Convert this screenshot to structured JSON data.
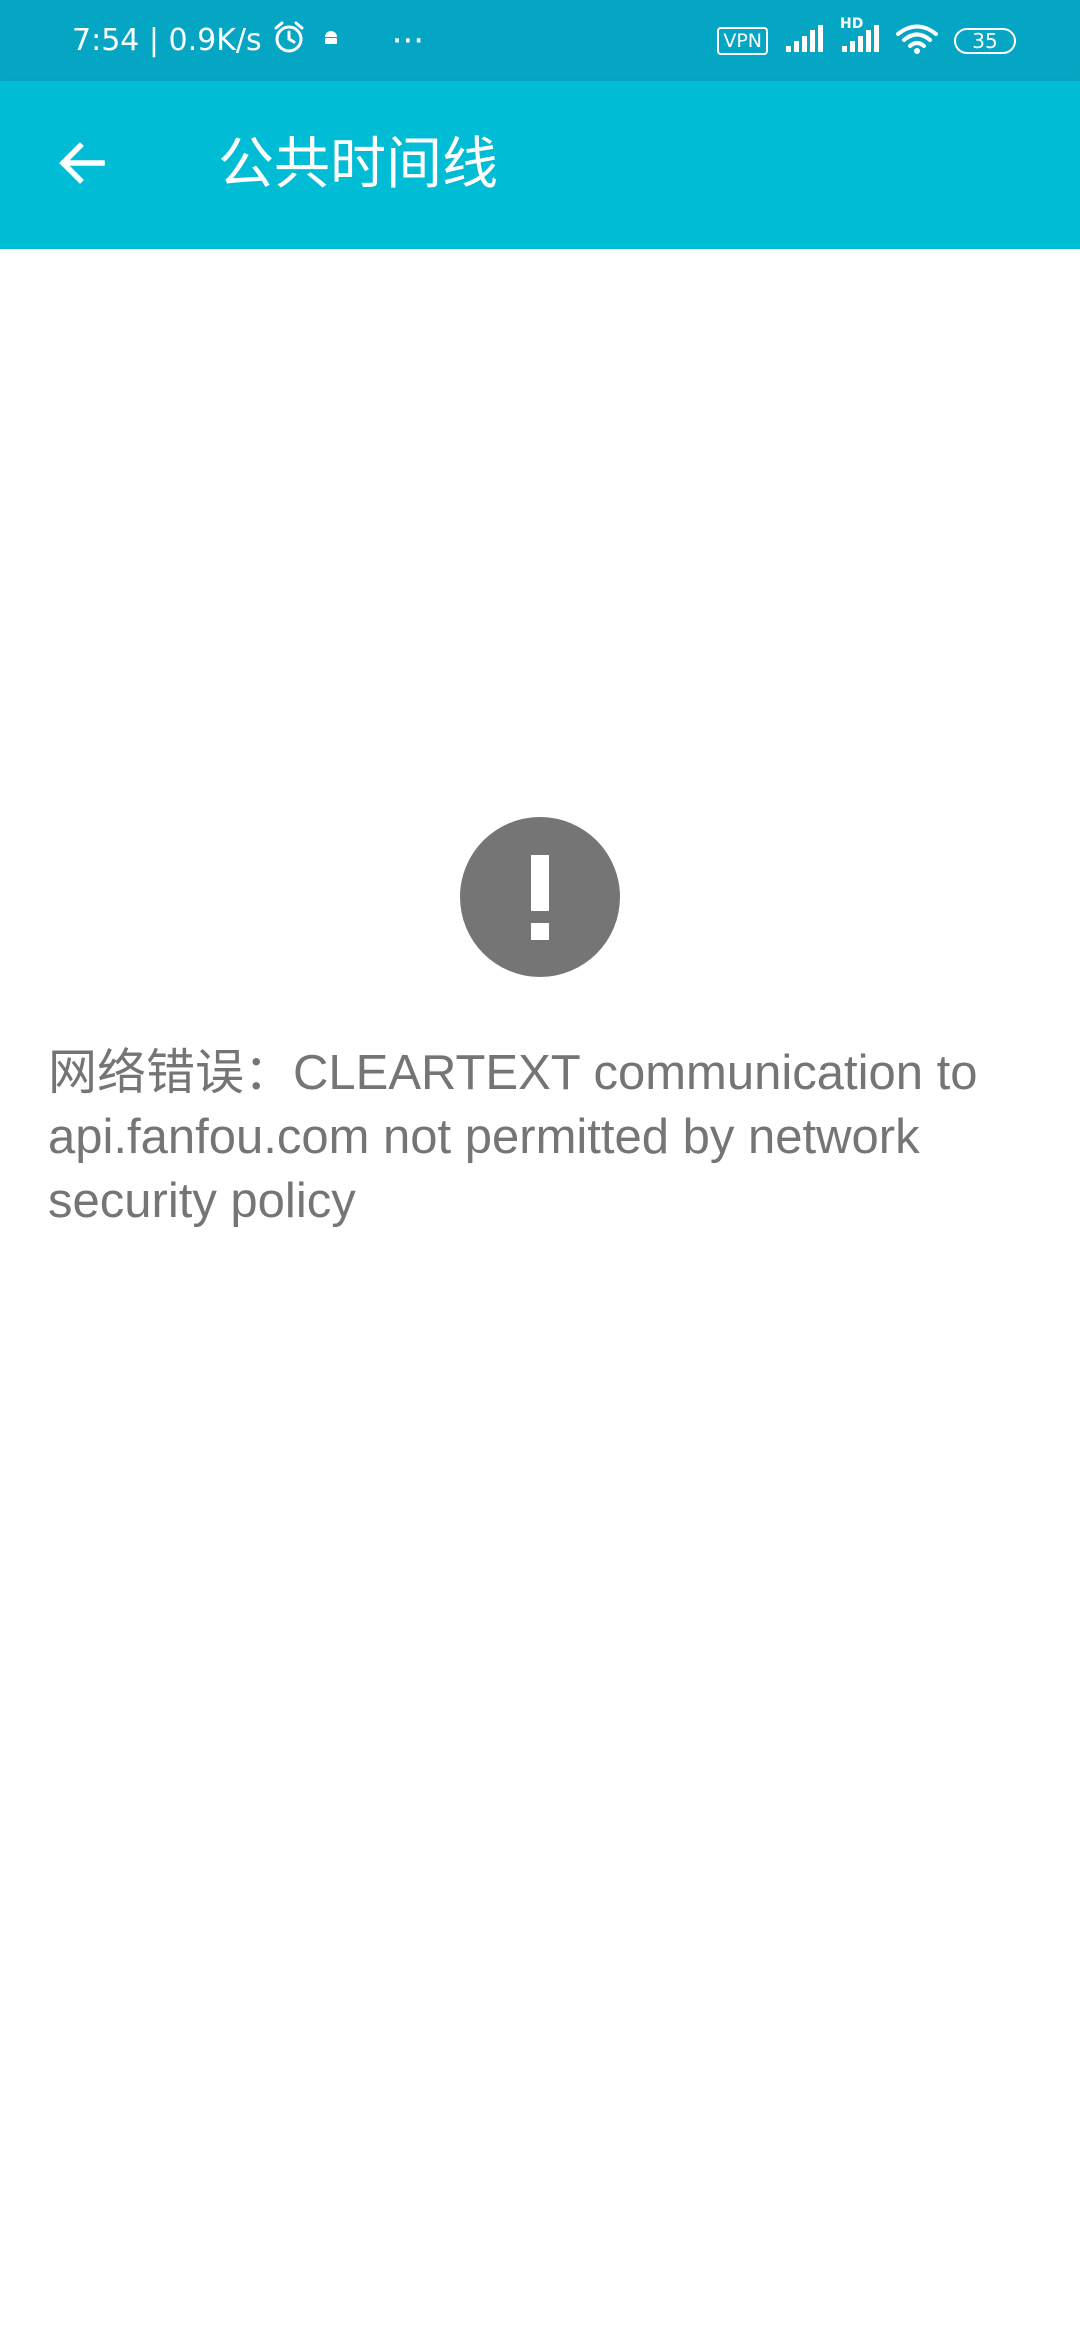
{
  "status_bar": {
    "time_speed": "7:54 | 0.9K/s",
    "more": "···",
    "vpn": "VPN",
    "signal_hd": "HD",
    "battery": "35",
    "icons": [
      "alarm-icon",
      "android-icon",
      "signal-icon",
      "signal-hd-icon",
      "wifi-icon",
      "battery-icon"
    ]
  },
  "app_bar": {
    "title": "公共时间线",
    "back_icon": "arrow-left-icon",
    "background_color": "#00bcd4"
  },
  "error": {
    "icon": "exclamation-circle-icon",
    "message": "网络错误：CLEARTEXT communication to api.fanfou.com not permitted by network security policy",
    "color": "#757575"
  }
}
